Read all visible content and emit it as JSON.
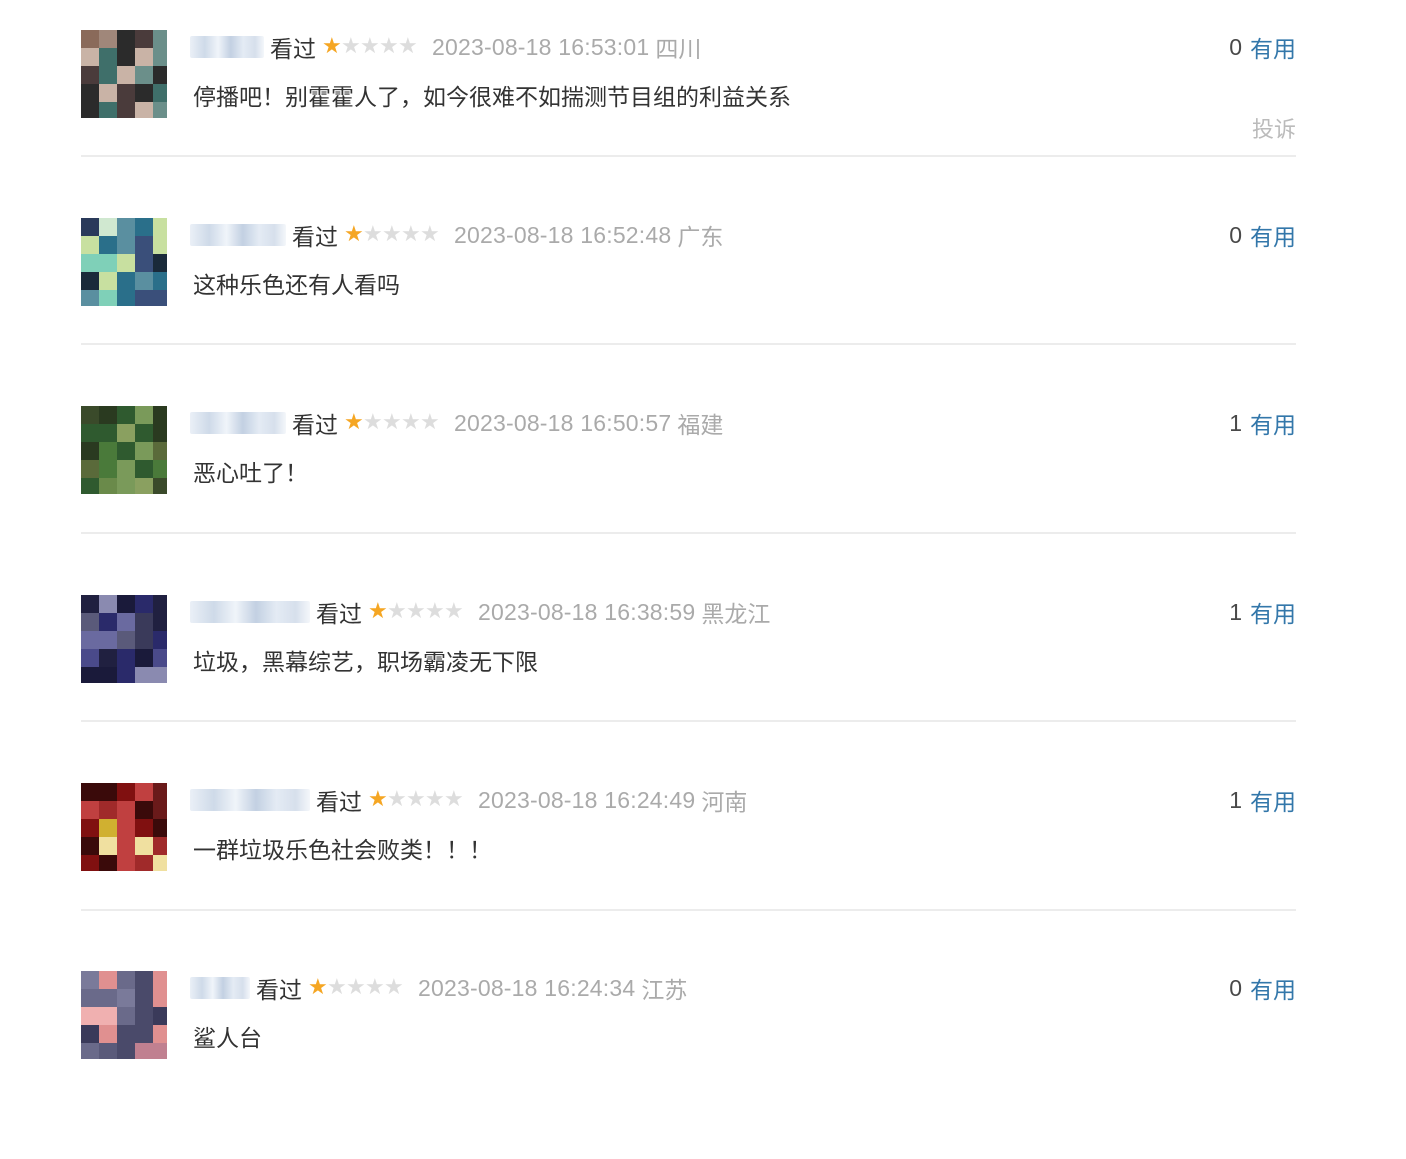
{
  "comments": [
    {
      "watched": "看过",
      "rating": 1,
      "rating_max": 5,
      "time": "2023-08-18 16:53:01",
      "region": "四川",
      "content": "停播吧！别霍霍人了，如今很难不如揣测节目组的利益关系",
      "votes": "0",
      "useful_label": "有用",
      "report_label": "投诉"
    },
    {
      "watched": "看过",
      "rating": 1,
      "rating_max": 5,
      "time": "2023-08-18 16:52:48",
      "region": "广东",
      "content": "这种乐色还有人看吗",
      "votes": "0",
      "useful_label": "有用"
    },
    {
      "watched": "看过",
      "rating": 1,
      "rating_max": 5,
      "time": "2023-08-18 16:50:57",
      "region": "福建",
      "content": "恶心吐了！",
      "votes": "1",
      "useful_label": "有用"
    },
    {
      "watched": "看过",
      "rating": 1,
      "rating_max": 5,
      "time": "2023-08-18 16:38:59",
      "region": "黑龙江",
      "content": "垃圾，黑幕综艺，职场霸凌无下限",
      "votes": "1",
      "useful_label": "有用"
    },
    {
      "watched": "看过",
      "rating": 1,
      "rating_max": 5,
      "time": "2023-08-18 16:24:49",
      "region": "河南",
      "content": "一群垃圾乐色社会败类！！！",
      "votes": "1",
      "useful_label": "有用"
    },
    {
      "watched": "看过",
      "rating": 1,
      "rating_max": 5,
      "time": "2023-08-18 16:24:34",
      "region": "江苏",
      "content": "鲨人台",
      "votes": "0",
      "useful_label": "有用"
    }
  ],
  "colors": {
    "star_on": "#f5a623",
    "star_off": "#dddddd",
    "link": "#3377aa",
    "muted": "#aaaaaa"
  },
  "icons": {
    "star": "star-icon"
  }
}
